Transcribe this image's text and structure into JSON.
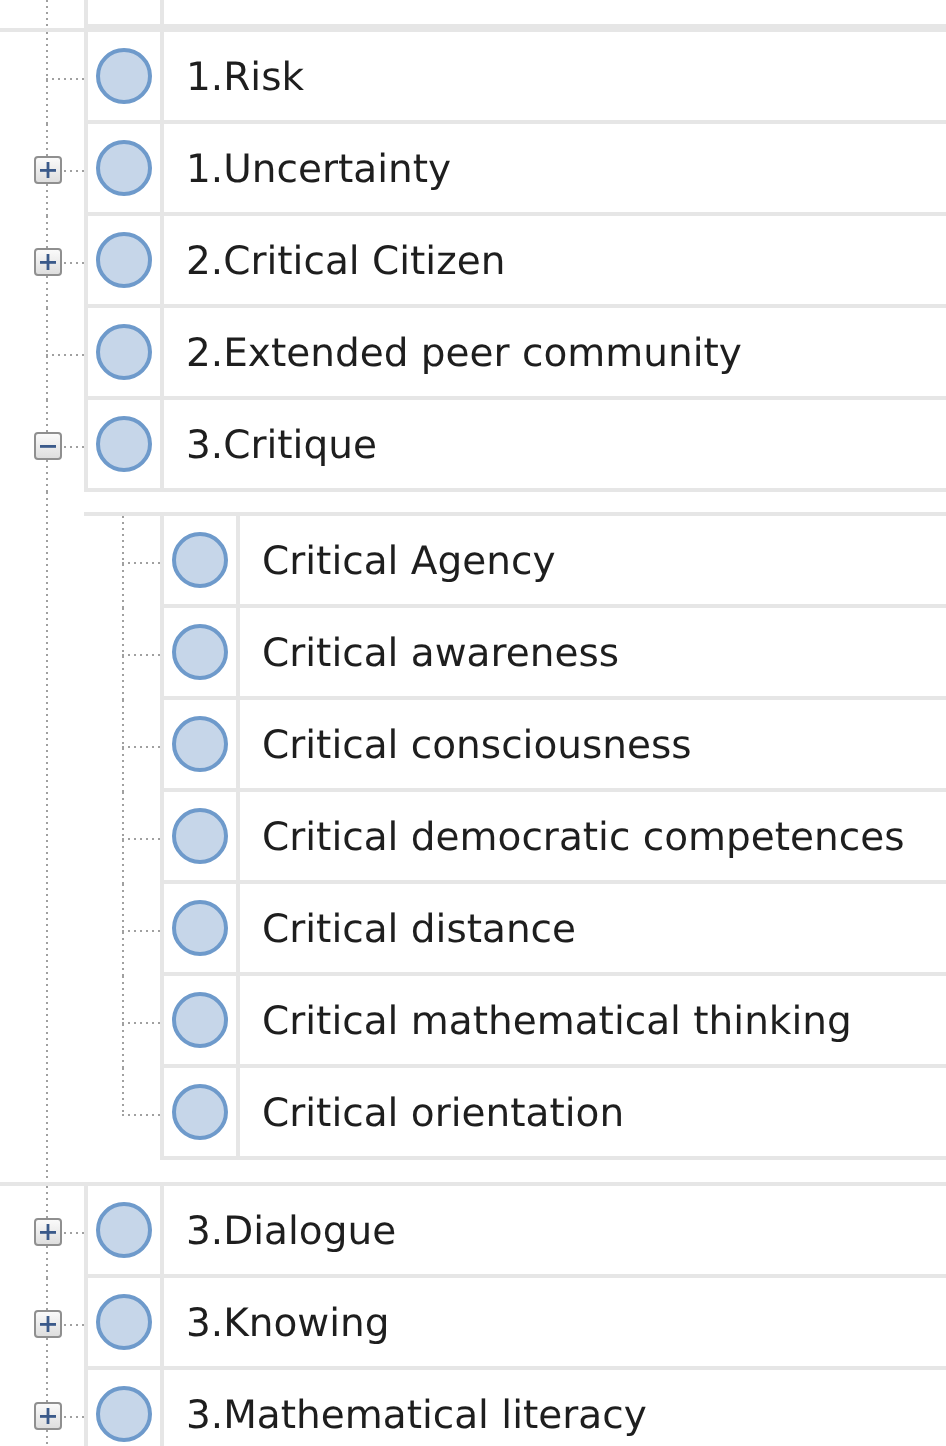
{
  "tree": {
    "items": [
      {
        "kind": "leaf",
        "label": "1.Risk"
      },
      {
        "kind": "branch",
        "label": "1.Uncertainty",
        "expanded": false
      },
      {
        "kind": "branch",
        "label": "2.Critical Citizen",
        "expanded": false
      },
      {
        "kind": "leaf",
        "label": "2.Extended peer community"
      },
      {
        "kind": "branch",
        "label": "3.Critique",
        "expanded": true,
        "children": [
          {
            "kind": "leaf",
            "label": "Critical Agency"
          },
          {
            "kind": "leaf",
            "label": "Critical awareness"
          },
          {
            "kind": "leaf",
            "label": "Critical consciousness"
          },
          {
            "kind": "leaf",
            "label": "Critical democratic competences"
          },
          {
            "kind": "leaf",
            "label": "Critical distance"
          },
          {
            "kind": "leaf",
            "label": "Critical mathematical thinking"
          },
          {
            "kind": "leaf",
            "label": "Critical orientation"
          }
        ]
      },
      {
        "kind": "branch",
        "label": "3.Dialogue",
        "expanded": false
      },
      {
        "kind": "branch",
        "label": "3.Knowing",
        "expanded": false
      },
      {
        "kind": "branch",
        "label": "3.Mathematical literacy",
        "expanded": false
      }
    ]
  }
}
